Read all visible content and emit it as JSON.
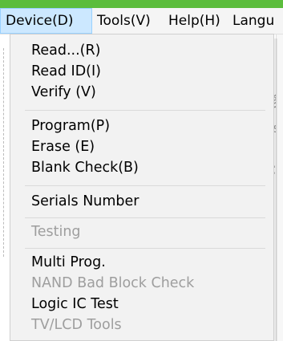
{
  "menubar": {
    "items": [
      {
        "label": "Device(D)"
      },
      {
        "label": "Tools(V)"
      },
      {
        "label": "Help(H)"
      },
      {
        "label": "Langu"
      }
    ]
  },
  "device_menu": {
    "items": [
      {
        "label": "Read...(R)",
        "enabled": true
      },
      {
        "label": "Read ID(I)",
        "enabled": true
      },
      {
        "label": "Verify (V)",
        "enabled": true
      },
      {
        "label": "Program(P)",
        "enabled": true
      },
      {
        "label": "Erase  (E)",
        "enabled": true
      },
      {
        "label": "Blank Check(B)",
        "enabled": true
      },
      {
        "label": "Serials Number",
        "enabled": true
      },
      {
        "label": "Testing",
        "enabled": false
      },
      {
        "label": "Multi Prog.",
        "enabled": true
      },
      {
        "label": "NAND Bad Block Check",
        "enabled": false
      },
      {
        "label": "Logic IC Test",
        "enabled": true
      },
      {
        "label": "TV/LCD Tools",
        "enabled": false
      }
    ]
  },
  "colors": {
    "accent_strip": "#5bbd3c",
    "menu_highlight": "#cce8ff",
    "disabled_text": "#9e9e9e"
  }
}
